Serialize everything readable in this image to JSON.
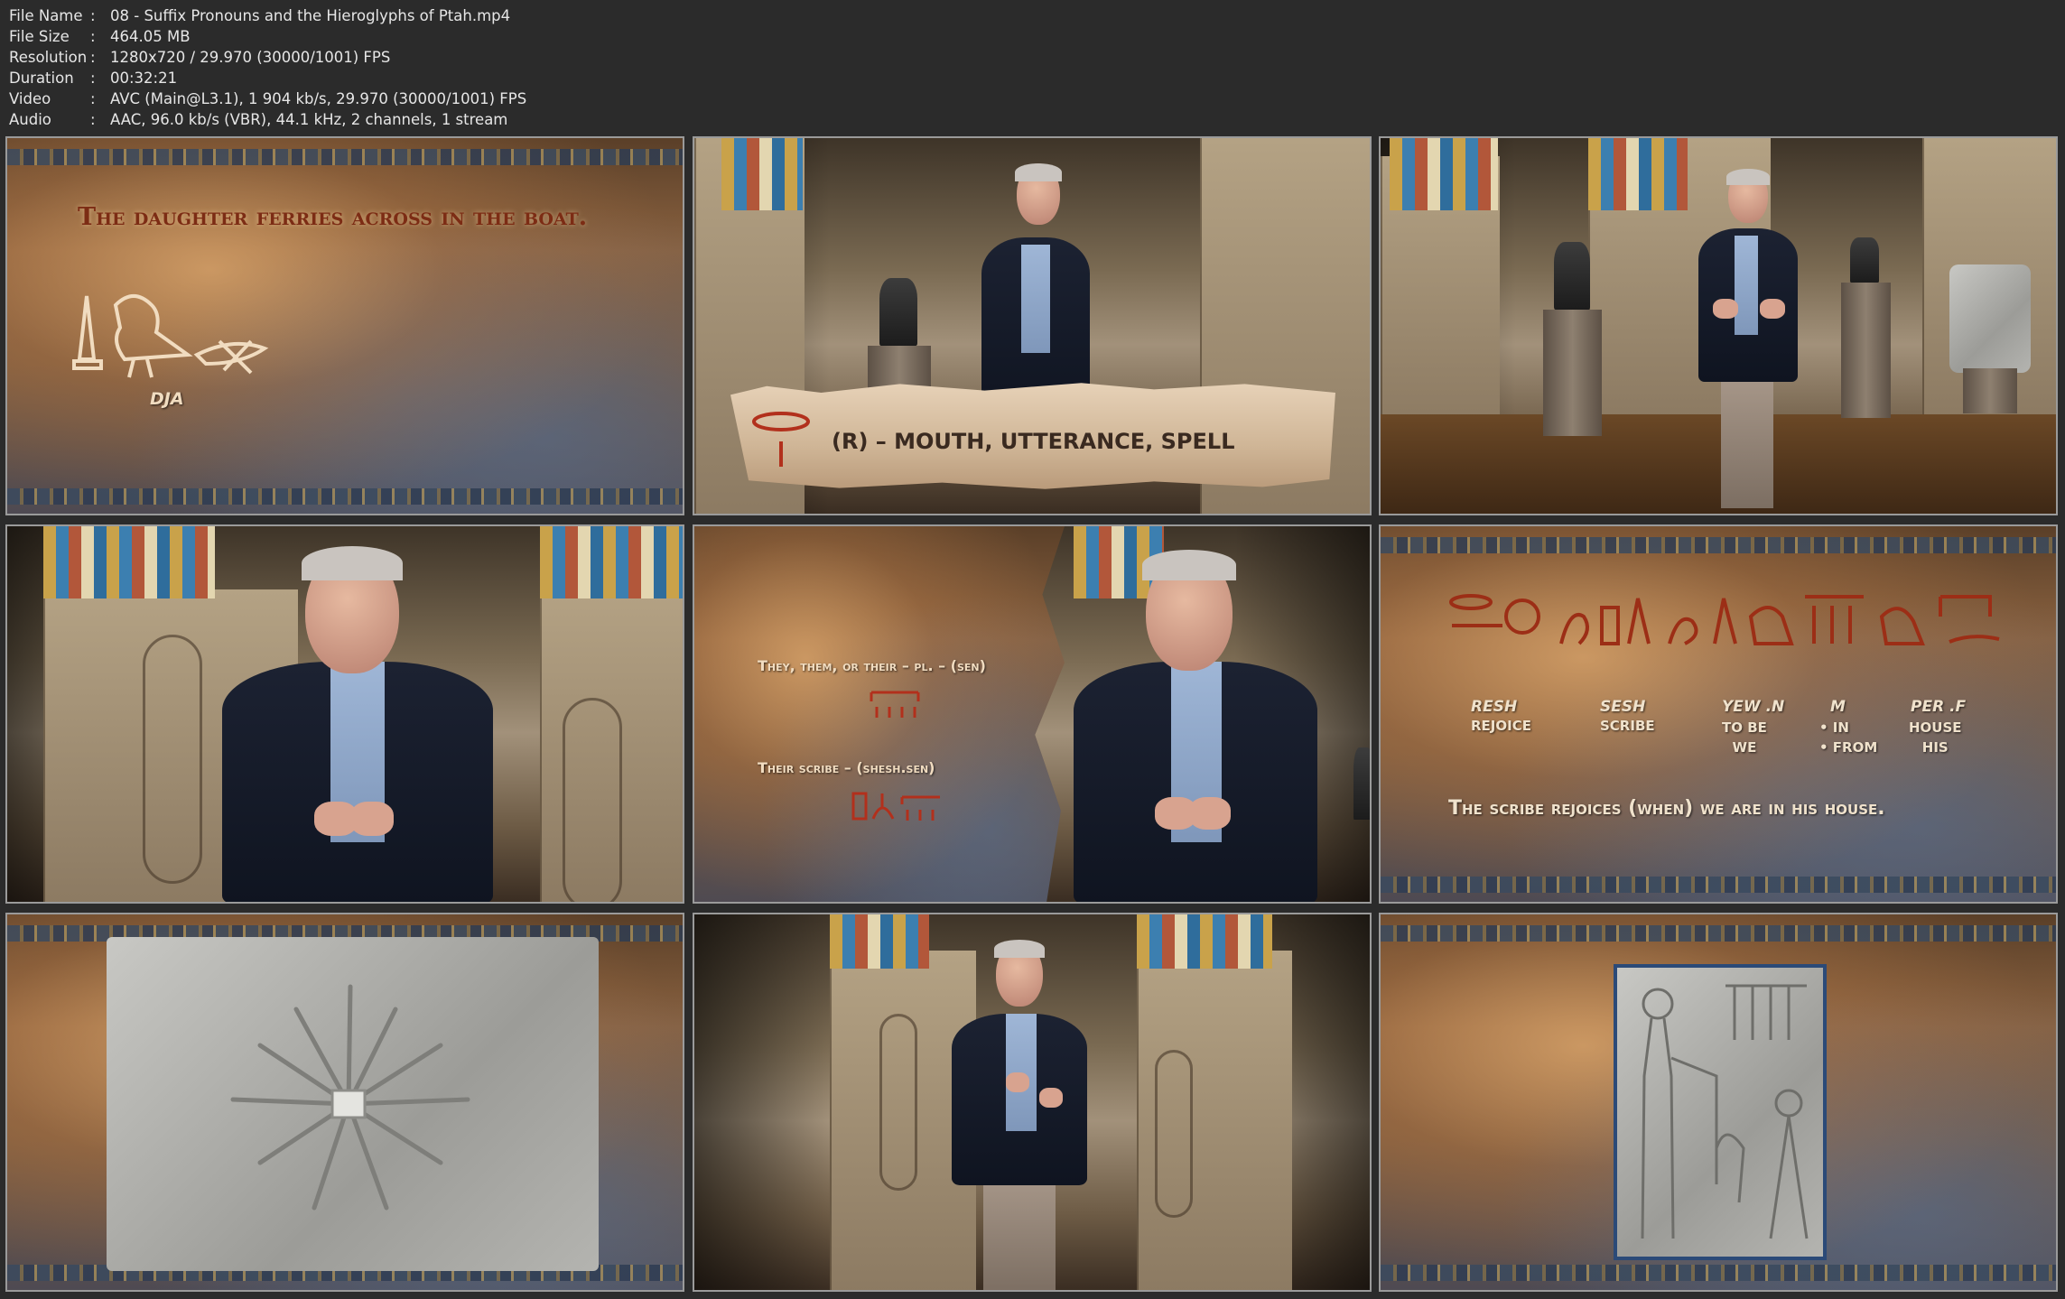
{
  "info": {
    "rows": [
      {
        "key": "File Name",
        "value": "08 - Suffix Pronouns and the Hieroglyphs of Ptah.mp4"
      },
      {
        "key": "File Size",
        "value": "464.05 MB"
      },
      {
        "key": "Resolution",
        "value": "1280x720 / 29.970 (30000/1001) FPS"
      },
      {
        "key": "Duration",
        "value": "00:32:21"
      },
      {
        "key": "Video",
        "value": "AVC (Main@L3.1), 1 904 kb/s, 29.970 (30000/1001) FPS"
      },
      {
        "key": "Audio",
        "value": "AAC, 96.0 kb/s (VBR), 44.1 kHz, 2 channels, 1 stream"
      }
    ],
    "separator": ":"
  },
  "thumb1": {
    "sentence": "The daughter ferries across in the boat.",
    "word": "DJA"
  },
  "thumb2": {
    "caption": "(R) – MOUTH, UTTERANCE, SPELL"
  },
  "thumb5": {
    "line1": "They, them, or their – pl. – (sen)",
    "line2": "Their scribe – (shesh.sen)"
  },
  "thumb6": {
    "words": [
      {
        "translit": "RESH",
        "gloss": "REJOICE"
      },
      {
        "translit": "SESH",
        "gloss": "SCRIBE"
      },
      {
        "translit": "YEW .N",
        "gloss": "TO BE\nWE"
      },
      {
        "translit": "M",
        "gloss": "• IN\n• FROM"
      },
      {
        "translit": "PER .F",
        "gloss": "HOUSE\nHIS"
      }
    ],
    "sentence": "The scribe rejoices (when) we are in his house."
  },
  "colors": {
    "background": "#2b2b2b",
    "info_text": "#e6e6e6",
    "glyph_red": "#8a2a12",
    "caption_light": "#f0e2cc"
  }
}
